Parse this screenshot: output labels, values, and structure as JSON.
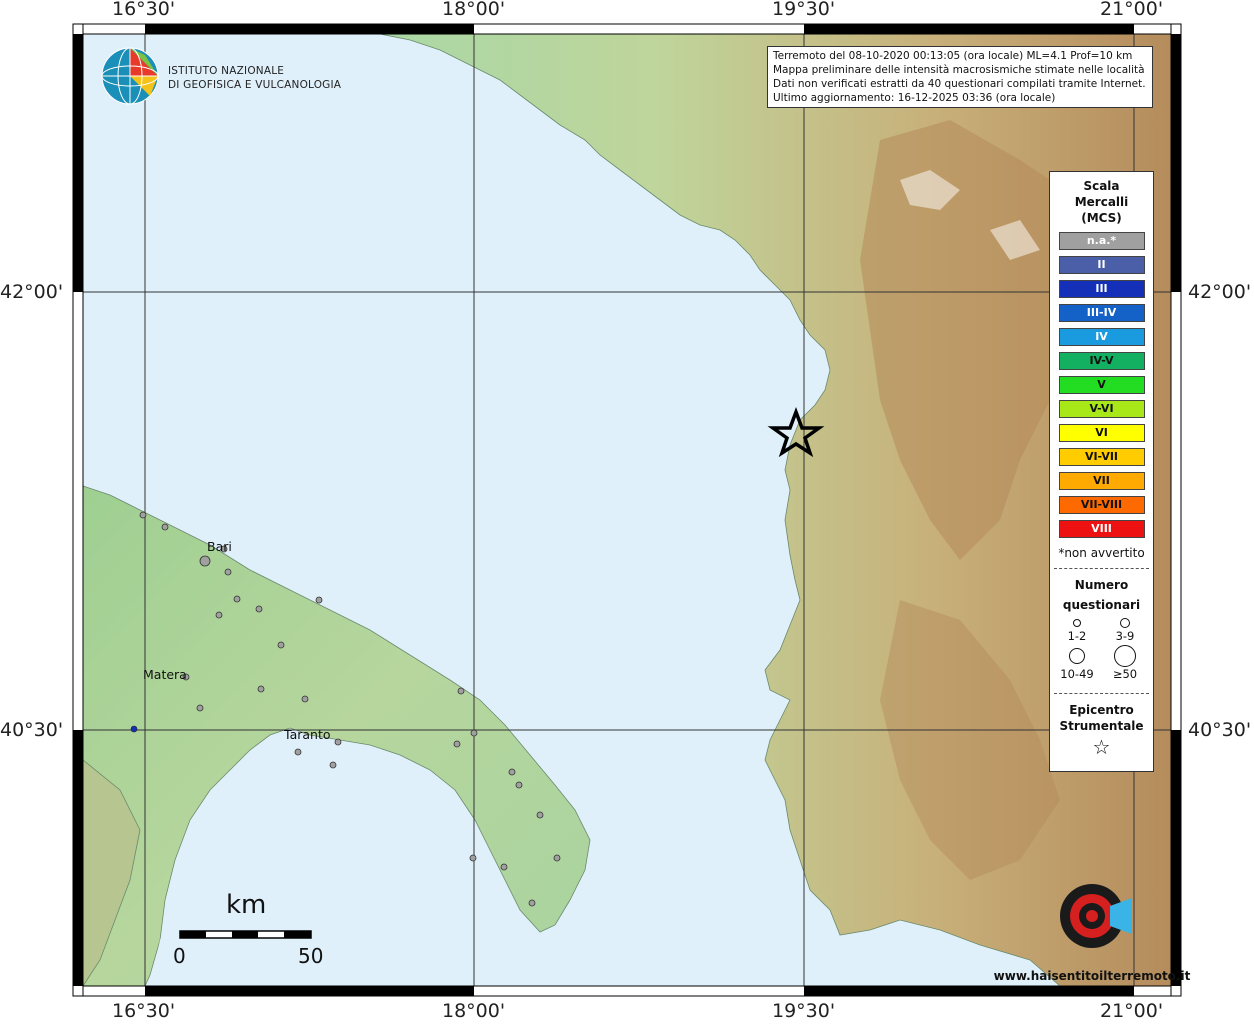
{
  "info": {
    "line1": "Terremoto del 08-10-2020 00:13:05 (ora locale) ML=4.1 Prof=10 km",
    "line2": "Mappa preliminare delle intensità macrosismiche stimate nelle località",
    "line3": "Dati non verificati estratti da 40 questionari compilati tramite Internet.",
    "line4": "Ultimo aggiornamento: 16-12-2025 03:36 (ora locale)"
  },
  "institute": {
    "line1": "ISTITUTO NAZIONALE",
    "line2": "DI GEOFISICA E VULCANOLOGIA"
  },
  "axes": {
    "lon_labels": [
      "16°30'",
      "18°00'",
      "19°30'",
      "21°00'"
    ],
    "lat_labels": [
      "42°00'",
      "40°30'"
    ]
  },
  "legend": {
    "title1": "Scala",
    "title2": "Mercalli",
    "title3": "(MCS)",
    "classes": [
      {
        "label": "n.a.*",
        "color": "#a0a0a0",
        "text": "#ffffff"
      },
      {
        "label": "II",
        "color": "#4a5fa8",
        "text": "#ffffff"
      },
      {
        "label": "III",
        "color": "#1530b8",
        "text": "#ffffff"
      },
      {
        "label": "III-IV",
        "color": "#1462c8",
        "text": "#ffffff"
      },
      {
        "label": "IV",
        "color": "#1a9be0",
        "text": "#ffffff"
      },
      {
        "label": "IV-V",
        "color": "#12b060",
        "text": "#111111"
      },
      {
        "label": "V",
        "color": "#22dd22",
        "text": "#111111"
      },
      {
        "label": "V-VI",
        "color": "#a8e818",
        "text": "#111111"
      },
      {
        "label": "VI",
        "color": "#ffff00",
        "text": "#111111"
      },
      {
        "label": "VI-VII",
        "color": "#ffcc00",
        "text": "#111111"
      },
      {
        "label": "VII",
        "color": "#ffaa00",
        "text": "#111111"
      },
      {
        "label": "VII-VIII",
        "color": "#ff6a00",
        "text": "#111111"
      },
      {
        "label": "VIII",
        "color": "#ee1111",
        "text": "#ffffff"
      }
    ],
    "note": "*non avvertito",
    "count_title1": "Numero",
    "count_title2": "questionari",
    "count_labels": [
      "1-2",
      "3-9",
      "10-49",
      "≥50"
    ],
    "epicenter_title1": "Epicentro",
    "epicenter_title2": "Strumentale",
    "epicenter_symbol": "☆"
  },
  "scale_bar": {
    "unit": "km",
    "start": "0",
    "end": "50"
  },
  "cities": {
    "bari": "Bari",
    "matera": "Matera",
    "taranto": "Taranto"
  },
  "hsit_logo": "www.haisentitoilterremoto.it",
  "colors": {
    "sea": "#dff0fb",
    "land_low": "#a8d5a0",
    "land_mid": "#c9d69a",
    "land_high": "#b99565",
    "grid": "#333333",
    "point_fill": "#a0a0a0"
  }
}
